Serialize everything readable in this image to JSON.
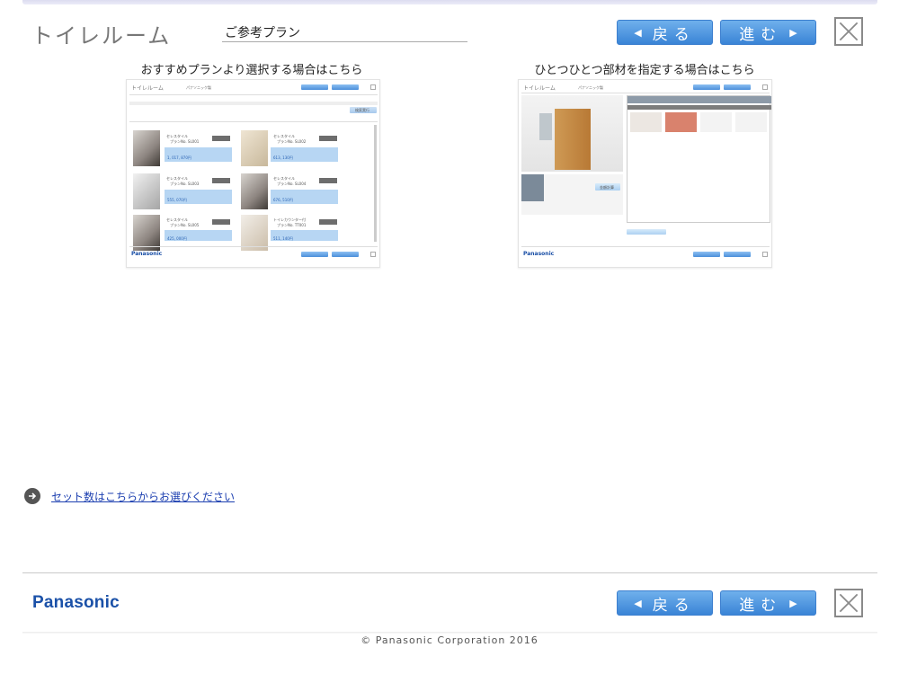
{
  "header": {
    "title": "トイレルーム",
    "subtitle": "ご参考プラン",
    "back_label": "戻る",
    "next_label": "進む"
  },
  "choices": {
    "recommended_label": "おすすめプランより選択する場合はこちら",
    "parts_label": "ひとつひとつ部材を指定する場合はこちら"
  },
  "thumb_left": {
    "title": "トイレルーム",
    "maker": "パナソニック製",
    "search_btn": "検索実行",
    "logo": "Panasonic",
    "cards": [
      {
        "name": "セレスタイル",
        "plan": "プランNo. SL001",
        "price": "1, 017, 870円"
      },
      {
        "name": "セレスタイル",
        "plan": "プランNo. SL002",
        "price": "613, 130円"
      },
      {
        "name": "セレスタイル",
        "plan": "プランNo. SL003",
        "price": "555, 070円"
      },
      {
        "name": "セレスタイル",
        "plan": "プランNo. SL004",
        "price": "676, 510円"
      },
      {
        "name": "セレスタイル",
        "plan": "プランNo. SL005",
        "price": "425, 000円"
      },
      {
        "name": "トイレカウンター付",
        "plan": "プランNo. TT001",
        "price": "511, 140円"
      }
    ]
  },
  "thumb_right": {
    "title": "トイレルーム",
    "maker": "パナソニック製",
    "calc_btn": "金額計算",
    "logo": "Panasonic"
  },
  "link": {
    "text": "セット数はこちらからお選びください"
  },
  "footer": {
    "logo": "Panasonic",
    "back_label": "戻る",
    "next_label": "進む",
    "copyright": "© Panasonic Corporation   2016"
  }
}
